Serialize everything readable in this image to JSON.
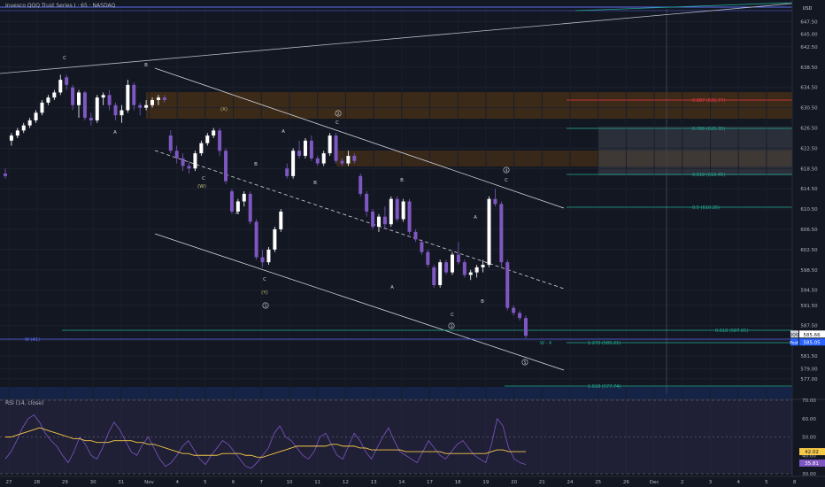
{
  "header": {
    "symbol_title": "Invesco QQQ Trust Series I · 65 · NASDAQ",
    "currency": "USD"
  },
  "chart_data": {
    "type": "candlestick",
    "symbol": "QQQ",
    "y_range": [
      574.0,
      650.0
    ],
    "grid": true,
    "y_ticks": [
      647.5,
      645.0,
      642.5,
      638.5,
      634.5,
      630.5,
      626.5,
      622.5,
      618.5,
      614.5,
      610.5,
      606.5,
      602.5,
      598.5,
      594.5,
      591.5,
      587.5,
      584.5,
      581.5,
      579.0,
      577.0
    ],
    "x_ticks": [
      "27",
      "28",
      "29",
      "30",
      "31",
      "Nov",
      "4",
      "5",
      "6",
      "7",
      "10",
      "11",
      "12",
      "13",
      "14",
      "17",
      "18",
      "19",
      "20",
      "21",
      "24",
      "25",
      "26",
      "Dec",
      "2",
      "3",
      "4",
      "5",
      "8"
    ],
    "last_price": "585.66",
    "last_price_tag": "QQQ",
    "post_price": "585.05",
    "post_tag": "Post",
    "candles_ohlc": [
      [
        617.5,
        618.5,
        616.5,
        617.0
      ],
      [
        624.0,
        625.5,
        623.0,
        625.0
      ],
      [
        625.0,
        626.5,
        624.5,
        626.0
      ],
      [
        626.0,
        627.5,
        625.5,
        627.0
      ],
      [
        627.0,
        628.5,
        626.5,
        628.0
      ],
      [
        628.0,
        630.0,
        627.5,
        629.5
      ],
      [
        629.5,
        632.0,
        629.0,
        631.5
      ],
      [
        631.5,
        633.0,
        631.0,
        632.5
      ],
      [
        632.5,
        634.0,
        632.0,
        633.5
      ],
      [
        633.5,
        637.0,
        633.0,
        636.0
      ],
      [
        636.5,
        637.0,
        634.0,
        635.0
      ],
      [
        634.5,
        635.0,
        630.0,
        631.0
      ],
      [
        631.0,
        634.0,
        628.5,
        633.5
      ],
      [
        633.5,
        633.8,
        628.0,
        628.5
      ],
      [
        628.5,
        629.5,
        627.0,
        628.0
      ],
      [
        628.0,
        633.0,
        627.5,
        632.5
      ],
      [
        632.5,
        633.5,
        631.0,
        633.0
      ],
      [
        633.0,
        634.0,
        630.0,
        631.0
      ],
      [
        631.0,
        631.5,
        628.0,
        629.0
      ],
      [
        629.0,
        631.0,
        627.5,
        630.0
      ],
      [
        630.0,
        636.0,
        629.5,
        635.0
      ],
      [
        635.0,
        635.5,
        630.0,
        631.0
      ],
      [
        631.0,
        631.5,
        629.0,
        630.5
      ],
      [
        630.5,
        632.0,
        630.0,
        631.0
      ],
      [
        631.0,
        632.5,
        630.5,
        632.0
      ],
      [
        632.0,
        633.0,
        631.0,
        632.5
      ],
      [
        632.5,
        633.0,
        631.5,
        632.0
      ],
      [
        625.0,
        626.0,
        621.5,
        622.0
      ],
      [
        622.0,
        623.0,
        619.5,
        620.5
      ],
      [
        620.5,
        621.5,
        618.0,
        619.0
      ],
      [
        619.0,
        620.0,
        617.5,
        618.5
      ],
      [
        618.5,
        622.0,
        618.0,
        621.5
      ],
      [
        621.5,
        624.0,
        621.0,
        623.5
      ],
      [
        623.5,
        625.5,
        623.0,
        625.0
      ],
      [
        625.0,
        626.5,
        624.5,
        626.0
      ],
      [
        626.0,
        626.5,
        621.0,
        622.0
      ],
      [
        622.0,
        622.5,
        615.5,
        616.0
      ],
      [
        614.0,
        614.5,
        609.5,
        610.0
      ],
      [
        610.0,
        612.5,
        609.5,
        612.0
      ],
      [
        612.0,
        614.0,
        611.0,
        613.5
      ],
      [
        613.5,
        614.0,
        607.5,
        608.0
      ],
      [
        608.0,
        608.5,
        600.5,
        601.0
      ],
      [
        601.0,
        602.5,
        599.0,
        600.0
      ],
      [
        600.0,
        603.0,
        599.5,
        602.5
      ],
      [
        602.5,
        607.0,
        602.0,
        606.5
      ],
      [
        606.5,
        610.5,
        606.0,
        610.0
      ],
      [
        618.5,
        619.5,
        616.5,
        617.0
      ],
      [
        617.0,
        622.5,
        616.5,
        622.0
      ],
      [
        622.0,
        624.0,
        620.5,
        621.0
      ],
      [
        621.0,
        624.5,
        620.5,
        624.0
      ],
      [
        624.0,
        625.0,
        620.0,
        620.5
      ],
      [
        620.5,
        621.0,
        619.0,
        619.5
      ],
      [
        619.5,
        622.0,
        619.0,
        621.5
      ],
      [
        621.5,
        625.5,
        621.0,
        625.0
      ],
      [
        625.0,
        625.5,
        619.5,
        620.0
      ],
      [
        620.0,
        620.5,
        619.0,
        619.5
      ],
      [
        619.5,
        622.0,
        619.0,
        621.0
      ],
      [
        621.0,
        621.5,
        619.5,
        620.0
      ],
      [
        617.0,
        617.5,
        613.0,
        613.5
      ],
      [
        613.5,
        614.0,
        609.0,
        610.0
      ],
      [
        610.0,
        610.5,
        606.5,
        607.0
      ],
      [
        607.0,
        609.5,
        606.0,
        609.0
      ],
      [
        609.0,
        611.0,
        606.5,
        607.5
      ],
      [
        607.5,
        613.0,
        607.0,
        612.5
      ],
      [
        612.5,
        613.0,
        608.0,
        608.5
      ],
      [
        608.5,
        612.5,
        608.0,
        612.0
      ],
      [
        612.0,
        612.5,
        605.5,
        606.0
      ],
      [
        606.0,
        606.5,
        604.0,
        604.5
      ],
      [
        604.0,
        604.5,
        601.5,
        602.0
      ],
      [
        602.0,
        602.5,
        599.0,
        599.5
      ],
      [
        599.0,
        599.5,
        595.0,
        595.5
      ],
      [
        595.5,
        600.5,
        595.0,
        600.0
      ],
      [
        600.0,
        600.5,
        597.5,
        598.0
      ],
      [
        598.0,
        602.0,
        597.5,
        601.5
      ],
      [
        601.5,
        604.0,
        599.5,
        600.0
      ],
      [
        600.0,
        600.5,
        597.0,
        597.5
      ],
      [
        597.5,
        598.5,
        596.5,
        598.0
      ],
      [
        598.0,
        599.5,
        597.0,
        599.0
      ],
      [
        599.0,
        600.5,
        598.0,
        599.5
      ],
      [
        599.5,
        613.0,
        599.0,
        612.5
      ],
      [
        612.5,
        614.5,
        611.0,
        611.5
      ],
      [
        611.5,
        612.0,
        599.0,
        600.0
      ],
      [
        600.0,
        600.5,
        590.5,
        591.0
      ],
      [
        591.0,
        591.5,
        589.5,
        590.0
      ],
      [
        590.0,
        590.5,
        588.5,
        589.0
      ],
      [
        589.0,
        589.5,
        585.0,
        585.5
      ]
    ],
    "annotations": [
      {
        "text": "C",
        "x": 73,
        "y": 67
      },
      {
        "text": "B",
        "x": 165,
        "y": 75
      },
      {
        "text": "A",
        "x": 130,
        "y": 151
      },
      {
        "text": "(X)",
        "x": 253,
        "y": 125
      },
      {
        "text": "C",
        "x": 230,
        "y": 203
      },
      {
        "text": "(W)",
        "x": 228,
        "y": 212
      },
      {
        "text": "B",
        "x": 289,
        "y": 187
      },
      {
        "text": "A",
        "x": 268,
        "y": 242
      },
      {
        "text": "C",
        "x": 299,
        "y": 317
      },
      {
        "text": "(Y)",
        "x": 299,
        "y": 332
      },
      {
        "text": "A",
        "x": 320,
        "y": 150
      },
      {
        "text": "C",
        "x": 381,
        "y": 140
      },
      {
        "text": "B",
        "x": 356,
        "y": 208
      },
      {
        "text": "B",
        "x": 454,
        "y": 205
      },
      {
        "text": "A",
        "x": 443,
        "y": 326
      },
      {
        "text": "A",
        "x": 537,
        "y": 247
      },
      {
        "text": "C",
        "x": 572,
        "y": 205
      },
      {
        "text": "B",
        "x": 545,
        "y": 342
      },
      {
        "text": "C",
        "x": 511,
        "y": 357
      }
    ],
    "wave_markers": [
      {
        "text": "2",
        "x": 382,
        "y": 130
      },
      {
        "text": "4",
        "x": 572,
        "y": 194
      },
      {
        "text": "1",
        "x": 300,
        "y": 347
      },
      {
        "text": "3",
        "x": 510,
        "y": 370
      },
      {
        "text": "5",
        "x": 593,
        "y": 411
      }
    ],
    "fib_levels": [
      {
        "label": "0.887 (631.77)",
        "color": "#f23645"
      },
      {
        "label": "0.786 (625.35)",
        "color": "#22ab94"
      },
      {
        "label": "0.618 (616.45)",
        "color": "#22ab94"
      },
      {
        "label": "0.5 (610.26)",
        "color": "#22ab94"
      },
      {
        "label": "0.618 (587.65)",
        "color": "#22ab94"
      },
      {
        "label": "1.272 (585.21)",
        "color": "#22ab94"
      },
      {
        "label": "1.618 (577.74)",
        "color": "#22ab94"
      }
    ],
    "marker_labels": [
      "W (A1)",
      "W - 4"
    ],
    "rsi": {
      "title": "RSI (14, close)",
      "range": [
        30,
        70
      ],
      "y_ticks": [
        "70.00",
        "60.00",
        "50.00",
        "40.00",
        "30.00"
      ],
      "value": "42.02",
      "ma_value": "35.81",
      "line_color": "#7e57c2",
      "ma_color": "#f7c948",
      "values": [
        38,
        42,
        48,
        55,
        60,
        62,
        58,
        52,
        48,
        45,
        40,
        36,
        42,
        50,
        46,
        40,
        38,
        44,
        52,
        58,
        54,
        48,
        42,
        40,
        46,
        50,
        44,
        38,
        34,
        36,
        40,
        45,
        48,
        43,
        38,
        35,
        40,
        44,
        48,
        46,
        42,
        38,
        34,
        33,
        36,
        40,
        44,
        52,
        56,
        50,
        48,
        44,
        40,
        38,
        42,
        50,
        52,
        46,
        40,
        38,
        45,
        52,
        48,
        42,
        38,
        44,
        50,
        55,
        48,
        42,
        40,
        38,
        36,
        42,
        48,
        44,
        40,
        38,
        42,
        46,
        48,
        44,
        40,
        38,
        36,
        46,
        60,
        56,
        44,
        38,
        36,
        35
      ],
      "ma_values": [
        50,
        50,
        51,
        52,
        53,
        54,
        55,
        54,
        53,
        52,
        51,
        50,
        49,
        49,
        48,
        48,
        47,
        47,
        47,
        48,
        48,
        48,
        48,
        47,
        47,
        46,
        46,
        45,
        44,
        43,
        42,
        41,
        41,
        40,
        40,
        40,
        40,
        40,
        41,
        41,
        41,
        41,
        40,
        40,
        39,
        39,
        40,
        41,
        42,
        43,
        44,
        45,
        45,
        45,
        45,
        45,
        45,
        46,
        46,
        45,
        45,
        45,
        44,
        44,
        43,
        43,
        43,
        43,
        43,
        43,
        42,
        42,
        42,
        42,
        42,
        42,
        42,
        41,
        41,
        41,
        41,
        41,
        41,
        41,
        41,
        42,
        43,
        43,
        42,
        42,
        42,
        42
      ]
    }
  }
}
